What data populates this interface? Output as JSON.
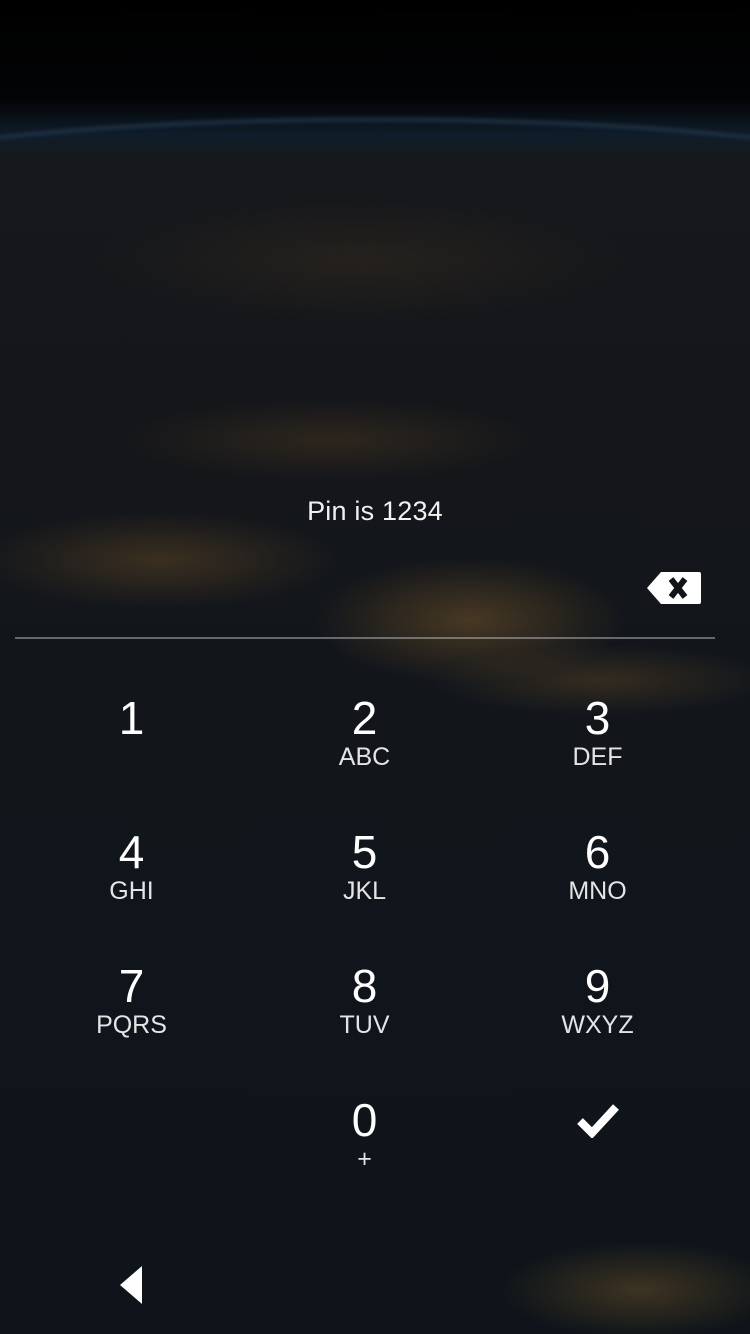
{
  "pin_hint": "Pin is 1234",
  "pin_entry": {
    "value": "",
    "backspace_icon": "backspace-icon"
  },
  "keypad": {
    "keys": [
      {
        "digit": "1",
        "letters": ""
      },
      {
        "digit": "2",
        "letters": "ABC"
      },
      {
        "digit": "3",
        "letters": "DEF"
      },
      {
        "digit": "4",
        "letters": "GHI"
      },
      {
        "digit": "5",
        "letters": "JKL"
      },
      {
        "digit": "6",
        "letters": "MNO"
      },
      {
        "digit": "7",
        "letters": "PQRS"
      },
      {
        "digit": "8",
        "letters": "TUV"
      },
      {
        "digit": "9",
        "letters": "WXYZ"
      },
      {
        "digit": "0",
        "letters": "+"
      }
    ],
    "confirm_icon": "check-icon"
  },
  "navigation": {
    "back_icon": "back-triangle-icon"
  },
  "colors": {
    "text": "#ffffff",
    "underline": "#c8cdd2",
    "background": "#0f151b"
  }
}
